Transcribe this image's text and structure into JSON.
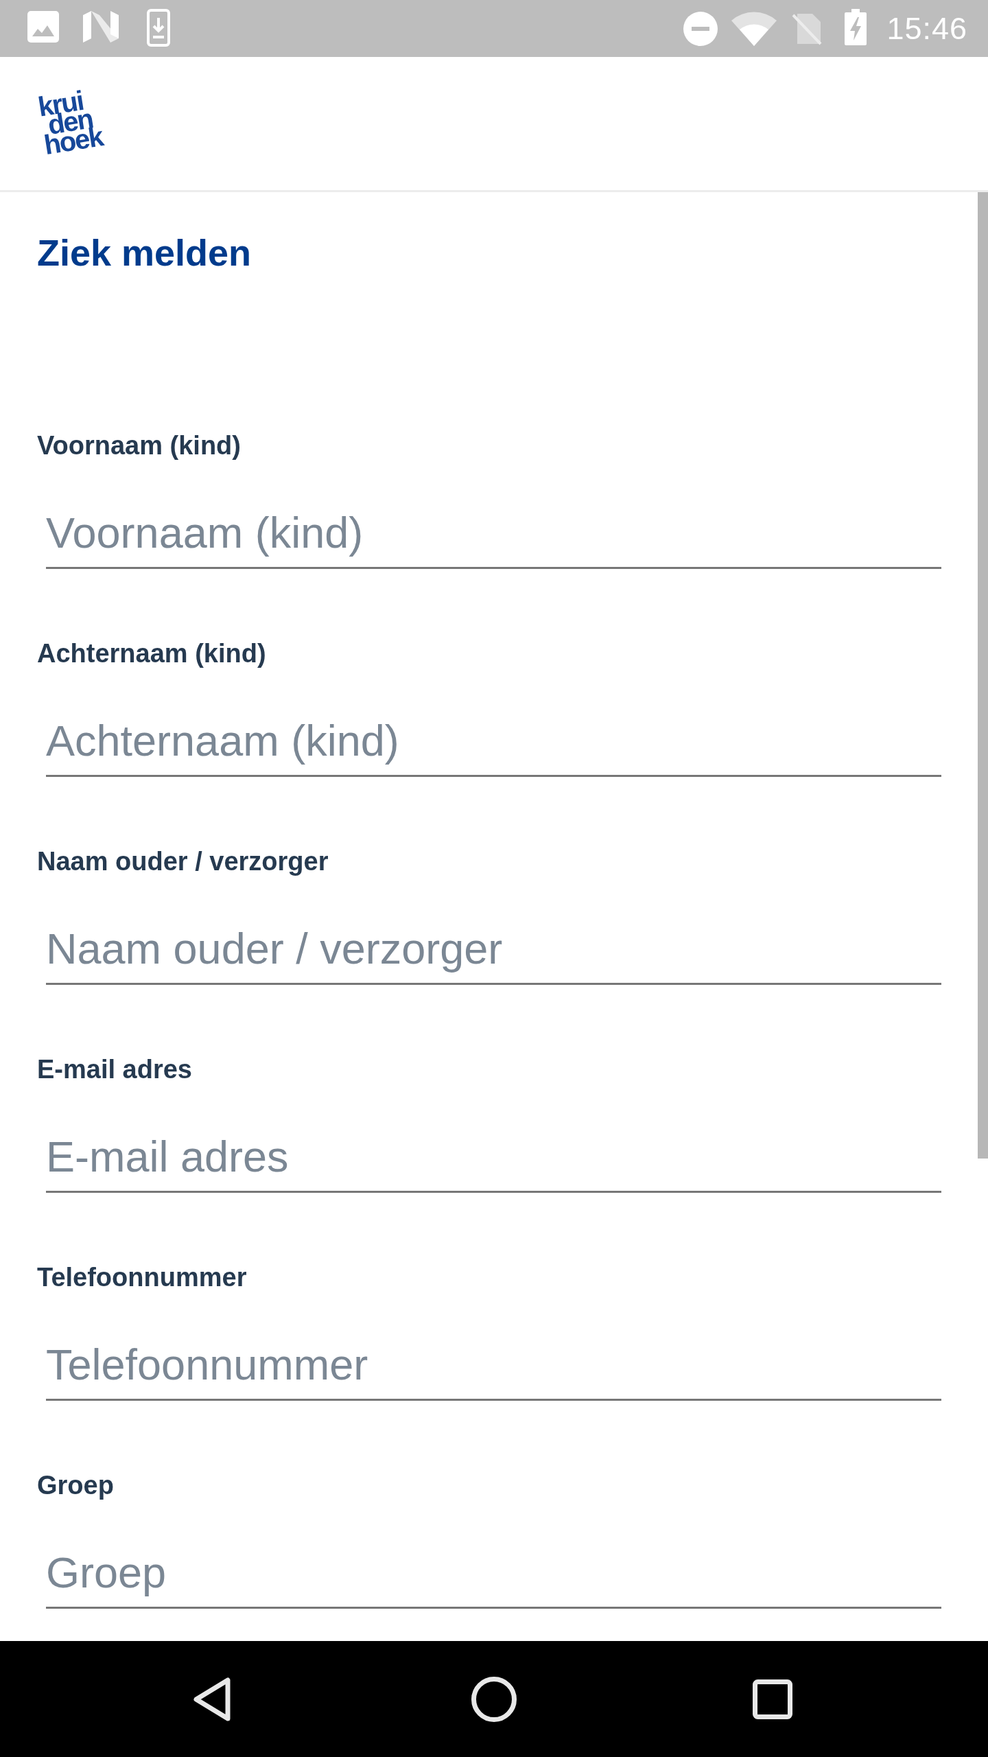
{
  "status_bar": {
    "time": "15:46"
  },
  "header": {
    "logo": {
      "lines": [
        "krui",
        "den",
        "hoek"
      ]
    }
  },
  "page": {
    "title": "Ziek melden"
  },
  "form": {
    "fields": [
      {
        "label": "Voornaam (kind)",
        "placeholder": "Voornaam (kind)"
      },
      {
        "label": "Achternaam (kind)",
        "placeholder": "Achternaam (kind)"
      },
      {
        "label": "Naam ouder / verzorger",
        "placeholder": "Naam ouder / verzorger"
      },
      {
        "label": "E-mail adres",
        "placeholder": "E-mail adres"
      },
      {
        "label": "Telefoonnummer",
        "placeholder": "Telefoonnummer"
      },
      {
        "label": "Groep",
        "placeholder": "Groep"
      }
    ]
  }
}
